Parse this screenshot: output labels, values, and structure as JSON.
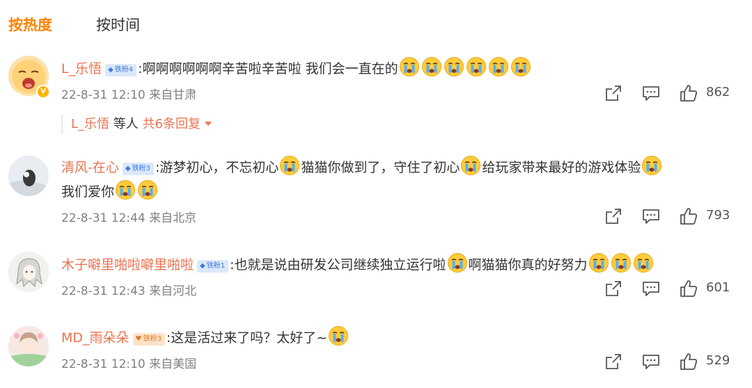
{
  "tabs": [
    {
      "label": "按热度",
      "active": true
    },
    {
      "label": "按时间",
      "active": false
    }
  ],
  "comments": [
    {
      "username": "L_乐悟",
      "badge": "铁粉4",
      "text_parts": [
        ":啊啊啊啊啊啊辛苦啦辛苦啦 我们会一直在的"
      ],
      "emoji_count": 6,
      "meta": "22-8-31 12:10 来自甘肃",
      "likes": "862",
      "replies": {
        "user": "L_乐悟",
        "middle": "等人",
        "count_label": "共6条回复"
      }
    },
    {
      "username": "清风-在心",
      "badge": "铁粉3",
      "text_parts": [
        ":游梦初心，不忘初心",
        "猫猫你做到了，守住了初心",
        "给玩家带来最好的游戏体验",
        "我们爱你"
      ],
      "meta": "22-8-31 12:44 来自北京",
      "likes": "793"
    },
    {
      "username": "木子噼里啪啦噼里啪啦",
      "badge": "铁粉1",
      "text_parts": [
        ":也就是说由研发公司继续独立运行啦",
        "啊猫猫你真的好努力"
      ],
      "meta": "22-8-31 12:43 来自河北",
      "likes": "601"
    },
    {
      "username": "MD_雨朵朵",
      "badge": "铁粉3",
      "text_parts": [
        ":这是活过来了吗？太好了~"
      ],
      "meta": "22-8-31 12:10 来自美国",
      "likes": "529"
    }
  ],
  "icons": {
    "share": "share-icon",
    "comment": "comment-icon",
    "like": "thumbs-up-icon",
    "emoji": "crying-face-emoji"
  },
  "colors": {
    "active_tab": "#ff8200",
    "username": "#eb7350",
    "meta": "#808080",
    "text": "#333333"
  }
}
